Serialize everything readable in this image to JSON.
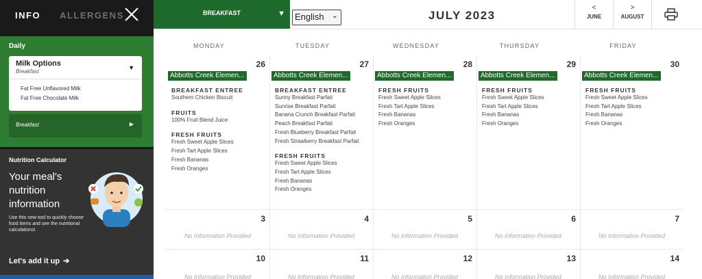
{
  "sidebar": {
    "tabs": [
      {
        "label": "INFO"
      },
      {
        "label": "ALLERGENS"
      }
    ],
    "daily": {
      "label": "Daily",
      "milk": {
        "title": "Milk Options",
        "subtitle": "Breakfast",
        "options": [
          "Fat Free Unflavored Milk",
          "Fat Free Chocolate Milk"
        ]
      },
      "meal_row": "Breakfast"
    },
    "nutrition": {
      "title": "Nutrition Calculator",
      "headline": "Your meal's nutrition information",
      "body": "Use this new tool to quickly choose food items and see the nutritional calculations!",
      "link": "Let's add it up",
      "link_icon": "arrow-right-icon"
    }
  },
  "topbar": {
    "meal_select": "BREAKFAST",
    "language": "English",
    "month_title": "JULY 2023",
    "prev_label": "JUNE",
    "next_label": "AUGUST",
    "print_icon": "printer-icon"
  },
  "calendar": {
    "weekdays": [
      "MONDAY",
      "TUESDAY",
      "WEDNESDAY",
      "THURSDAY",
      "FRIDAY"
    ],
    "week1": [
      {
        "date": "26",
        "school": "Abbotts Creek Elemen...",
        "groups": [
          {
            "category": "BREAKFAST ENTREE",
            "items": [
              "Southern Chicken Biscuit"
            ]
          },
          {
            "category": "FRUITS",
            "items": [
              "100% Fruit Blend Juice"
            ]
          },
          {
            "category": "FRESH FRUITS",
            "items": [
              "Fresh Sweet Apple Slices",
              "Fresh Tart Apple Slices",
              "Fresh Bananas",
              "Fresh Oranges"
            ]
          }
        ]
      },
      {
        "date": "27",
        "school": "Abbotts Creek Elemen...",
        "groups": [
          {
            "category": "BREAKFAST ENTREE",
            "items": [
              "Sunny Breakfast Parfait",
              "Sunrise Breakfast Parfait",
              "Banana Crunch Breakfast Parfait",
              "Peach Breakfast Parfait",
              "Fresh Blueberry Breakfast Parfait",
              "Fresh Strawberry Breakfast Parfait"
            ]
          },
          {
            "category": "FRESH FRUITS",
            "items": [
              "Fresh Sweet Apple Slices",
              "Fresh Tart Apple Slices",
              "Fresh Bananas",
              "Fresh Oranges"
            ]
          }
        ]
      },
      {
        "date": "28",
        "school": "Abbotts Creek Elemen...",
        "groups": [
          {
            "category": "FRESH FRUITS",
            "items": [
              "Fresh Sweet Apple Slices",
              "Fresh Tart Apple Slices",
              "Fresh Bananas",
              "Fresh Oranges"
            ]
          }
        ]
      },
      {
        "date": "29",
        "school": "Abbotts Creek Elemen...",
        "groups": [
          {
            "category": "FRESH FRUITS",
            "items": [
              "Fresh Sweet Apple Slices",
              "Fresh Tart Apple Slices",
              "Fresh Bananas",
              "Fresh Oranges"
            ]
          }
        ]
      },
      {
        "date": "30",
        "school": "Abbotts Creek Elemen...",
        "groups": [
          {
            "category": "FRESH FRUITS",
            "items": [
              "Fresh Sweet Apple Slices",
              "Fresh Tart Apple Slices",
              "Fresh Bananas",
              "Fresh Oranges"
            ]
          }
        ]
      }
    ],
    "week2": [
      {
        "date": "3",
        "note": "No Information Provided"
      },
      {
        "date": "4",
        "note": "No Information Provided"
      },
      {
        "date": "5",
        "note": "No Information Provided"
      },
      {
        "date": "6",
        "note": "No Information Provided"
      },
      {
        "date": "7",
        "note": "No Information Provided"
      }
    ],
    "week3": [
      {
        "date": "10",
        "note": "No Information Provided"
      },
      {
        "date": "11",
        "note": "No Information Provided"
      },
      {
        "date": "12",
        "note": "No Information Provided"
      },
      {
        "date": "13",
        "note": "No Information Provided"
      },
      {
        "date": "14",
        "note": "No Information Provided"
      }
    ]
  },
  "colors": {
    "green": "#2e7d32",
    "dark_green": "#1e6a2c",
    "sidebar": "#1a1a1a",
    "panel": "#333333"
  }
}
